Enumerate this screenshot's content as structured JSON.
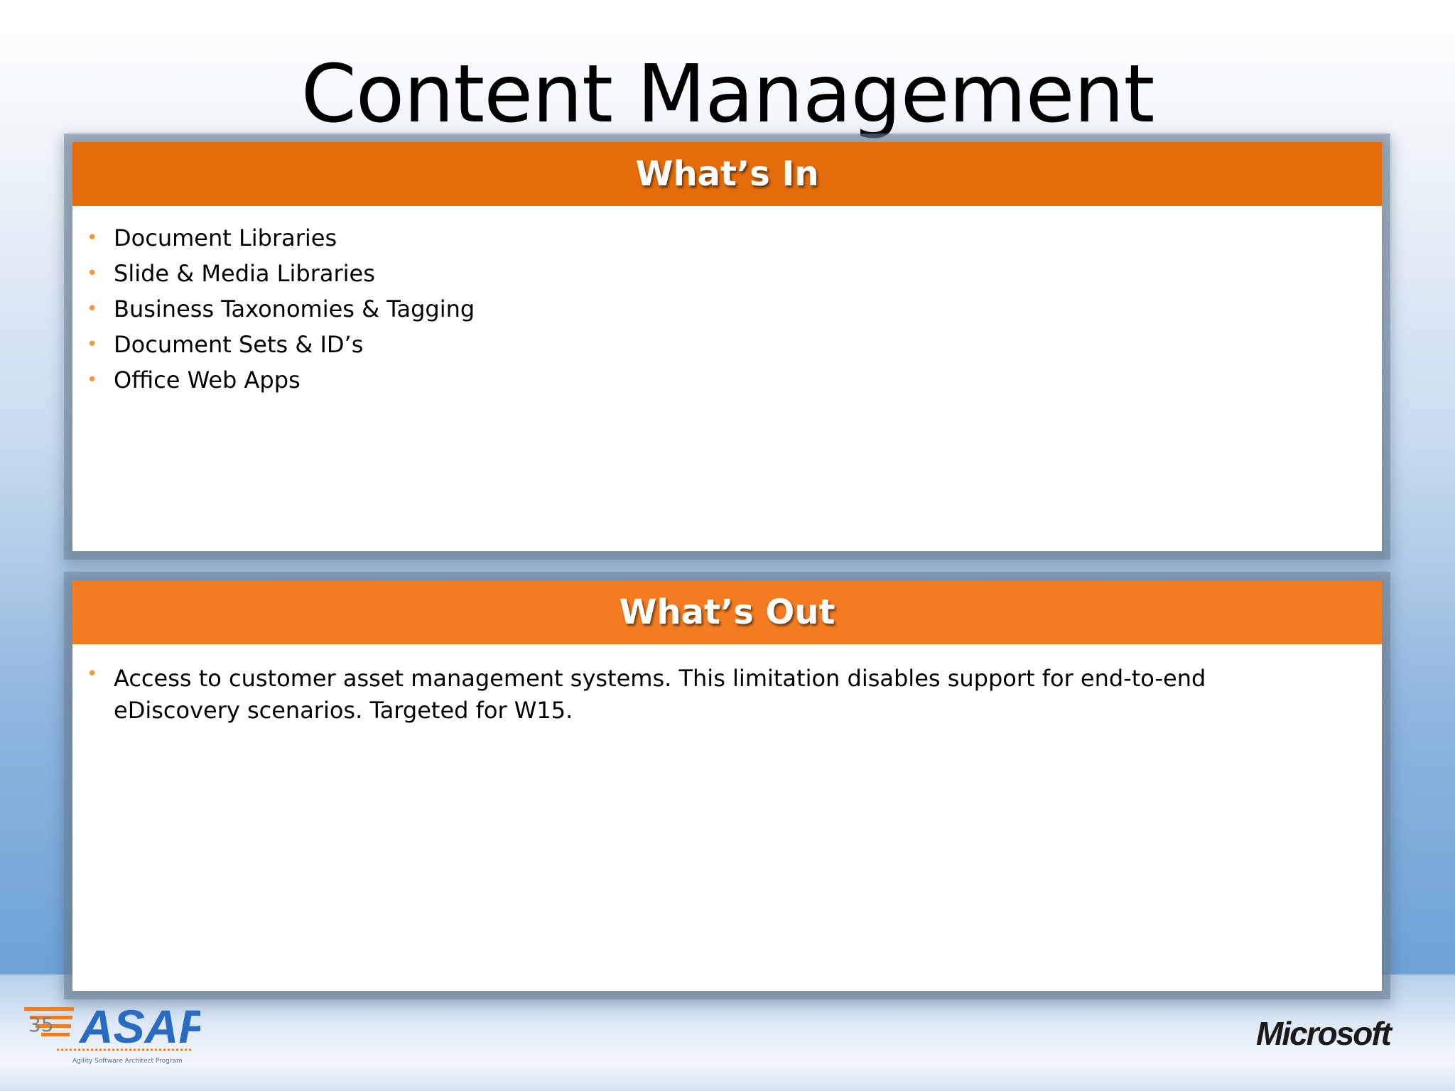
{
  "slide": {
    "title": "Content Management",
    "page_number": "35"
  },
  "whats_in": {
    "header": "What’s In",
    "items": [
      "Document Libraries",
      "Slide & Media Libraries",
      "Business Taxonomies & Tagging",
      "Document Sets & ID’s",
      "Office Web Apps"
    ]
  },
  "whats_out": {
    "header": "What’s Out",
    "items": [
      "Access to customer asset management systems.  This limitation disables support for end-to-end eDiscovery scenarios.  Targeted for W15."
    ]
  },
  "footer": {
    "left_logo": "ASAP",
    "left_logo_tagline": "Agility Software Architect Program",
    "right_logo": "Microsoft"
  },
  "colors": {
    "whats_in_header": "#e46c0a",
    "whats_out_header": "#f47b20",
    "bullet": "#f39a3c",
    "asap_orange": "#f07c22",
    "asap_blue": "#2a6bc2"
  }
}
